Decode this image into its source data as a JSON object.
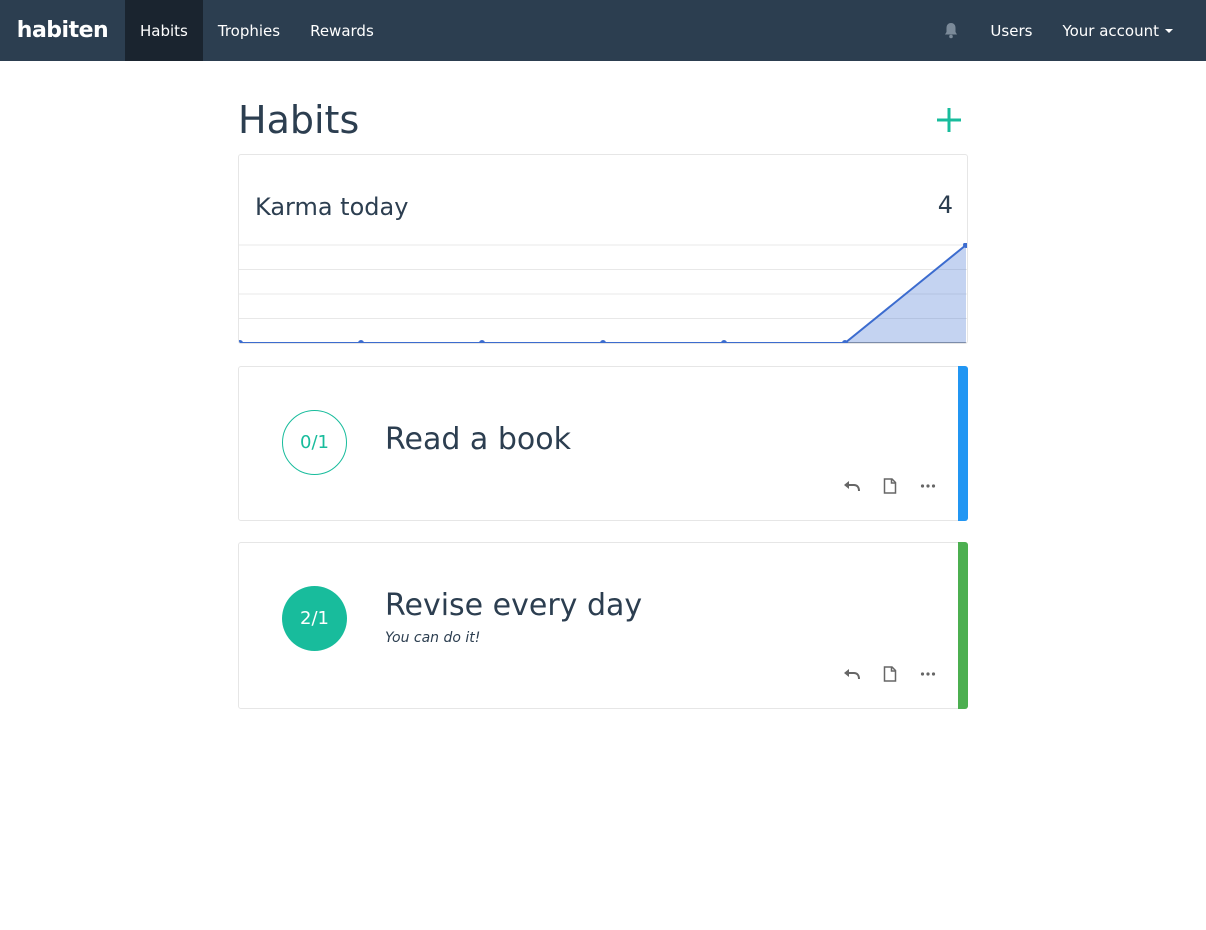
{
  "navbar": {
    "brand": "habiten",
    "items": [
      {
        "label": "Habits",
        "active": true
      },
      {
        "label": "Trophies",
        "active": false
      },
      {
        "label": "Rewards",
        "active": false
      }
    ],
    "right": {
      "bell_icon": "bell-icon",
      "users_label": "Users",
      "account_label": "Your account"
    }
  },
  "page": {
    "title": "Habits",
    "add_icon": "plus-icon"
  },
  "karma": {
    "label": "Karma today",
    "value": "4",
    "chart_data": {
      "type": "area",
      "values": [
        0,
        0,
        0,
        0,
        0,
        0,
        4
      ],
      "ylim": [
        0,
        4
      ],
      "grid": true,
      "color": "#3c6ccf"
    }
  },
  "habits": [
    {
      "counter": "0/1",
      "title": "Read a book",
      "subtitle": "",
      "done": false,
      "bar_color": "#2196f3"
    },
    {
      "counter": "2/1",
      "title": "Revise every day",
      "subtitle": "You can do it!",
      "done": true,
      "bar_color": "#4caf50"
    }
  ],
  "actions": {
    "undo_icon": "undo-icon",
    "note_icon": "note-icon",
    "more_icon": "more-icon"
  },
  "colors": {
    "navbar": "#2c3e50",
    "accent": "#18bc9c"
  }
}
